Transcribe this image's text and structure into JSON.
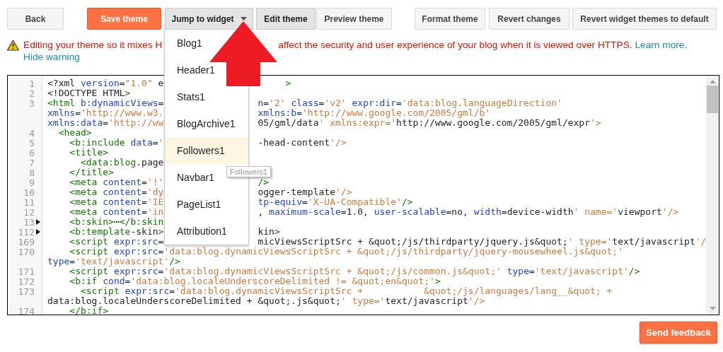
{
  "toolbar": {
    "buttons": [
      {
        "label": "Back",
        "kind": "plain"
      },
      {
        "label": "Save theme",
        "kind": "primary"
      },
      {
        "label": "Jump to widget",
        "kind": "dropdown",
        "expanded": true
      },
      {
        "label": "Edit theme",
        "kind": "toggle",
        "selected": true
      },
      {
        "label": "Preview theme",
        "kind": "toggle",
        "selected": false
      },
      {
        "label": "Format theme",
        "kind": "plain"
      },
      {
        "label": "Revert changes",
        "kind": "plain"
      },
      {
        "label": "Revert widget themes to default",
        "kind": "plain"
      }
    ]
  },
  "widget_menu": {
    "items": [
      {
        "label": "Blog1",
        "highlighted": false
      },
      {
        "label": "Header1",
        "highlighted": false
      },
      {
        "label": "Stats1",
        "highlighted": false
      },
      {
        "label": "BlogArchive1",
        "highlighted": false
      },
      {
        "label": "Followers1",
        "highlighted": true
      },
      {
        "label": "Navbar1",
        "highlighted": false
      },
      {
        "label": "PageList1",
        "highlighted": false
      },
      {
        "label": "Attribution1",
        "highlighted": false
      }
    ],
    "tooltip": "Followers1"
  },
  "warning": {
    "message_parts": [
      "Editing your theme so it mixes H",
      "affect the security and user experience of your blog when it is viewed over HTTPS."
    ],
    "links": [
      "Learn more.",
      "Hide warning"
    ]
  },
  "editor": {
    "lines": [
      {
        "number": "1",
        "folded": false,
        "segments": [
          "<?xml version=\"1.0\" e",
          "     >"
        ]
      },
      {
        "number": "2",
        "folded": false,
        "segments": [
          "<!DOCTYPE HTML>"
        ]
      },
      {
        "number": "3",
        "folded": false,
        "segments": [
          "<html b:dynamicViews=",
          "n='2' class='v2' expr:dir='data:blog.languageDirection'"
        ]
      },
      {
        "segments": [
          "xmlns='http://www.w3.",
          "xmlns:b='http://www.google.com/2005/gml/b'"
        ]
      },
      {
        "segments": [
          "xmlns:data='http://ww",
          "05/gml/data' xmlns:expr='http://www.google.com/2005/gml/expr'>"
        ]
      },
      {
        "number": "4",
        "folded": false,
        "segments": [
          "  <head>"
        ]
      },
      {
        "number": "5",
        "folded": false,
        "segments": [
          "    <b:include data='",
          "-head-content'/>"
        ]
      },
      {
        "number": "6",
        "folded": false,
        "segments": [
          "    <title>"
        ]
      },
      {
        "number": "7",
        "folded": false,
        "segments": [
          "      <data:blog.page"
        ]
      },
      {
        "number": "8",
        "folded": false,
        "segments": [
          "    </title>"
        ]
      },
      {
        "number": "9",
        "folded": false,
        "segments": [
          "    <meta content='!'",
          "/>"
        ]
      },
      {
        "number": "10",
        "folded": false,
        "segments": [
          "    <meta content='dy",
          "ogger-template'/>"
        ]
      },
      {
        "number": "11",
        "folded": false,
        "segments": [
          "    <meta content='IE",
          "tp-equiv='X-UA-Compatible'/>"
        ]
      },
      {
        "number": "12",
        "folded": false,
        "segments": [
          "    <meta content='in",
          ", maximum-scale=1.0, user-scalable=no, width=device-width' name='viewport'/>"
        ]
      },
      {
        "number": "13",
        "folded": true,
        "segments": [
          "    <b:skin>⋯</b:skin"
        ]
      },
      {
        "number": "112",
        "folded": true,
        "segments": [
          "    <b:template-skin>",
          "kin>"
        ]
      },
      {
        "number": "169",
        "folded": false,
        "segments": [
          "    <script expr:src=",
          "micViewsScriptSrc + &quot;/js/thirdparty/jquery.js&quot;' type='text/javascript'/"
        ]
      },
      {
        "number": "170",
        "folded": false,
        "segments": [
          "    <script expr:src='data:blog.dynamicViewsScriptSrc + &quot;/js/thirdparty/jquery-mousewheel.js&quot;'"
        ]
      },
      {
        "segments": [
          "type='text/javascript'/>"
        ]
      },
      {
        "number": "171",
        "folded": false,
        "segments": [
          "    <script expr:src='data:blog.dynamicViewsScriptSrc + &quot;/js/common.js&quot;' type='text/javascript'/>"
        ]
      },
      {
        "number": "172",
        "folded": false,
        "segments": [
          "    <b:if cond='data:blog.localeUnderscoreDelimited != &quot;en&quot;'>"
        ]
      },
      {
        "number": "173",
        "folded": false,
        "segments": [
          "      <script expr:src='data:blog.dynamicViewsScriptSrc +           &quot;/js/languages/lang__&quot; +"
        ]
      },
      {
        "segments": [
          "data:blog.localeUnderscoreDelimited + &quot;.js&quot;' type='text/javascript'/>"
        ]
      },
      {
        "number": "174",
        "folded": false,
        "segments": [
          "    </b:if>"
        ]
      }
    ]
  },
  "footer": {
    "button": "Send feedback"
  }
}
